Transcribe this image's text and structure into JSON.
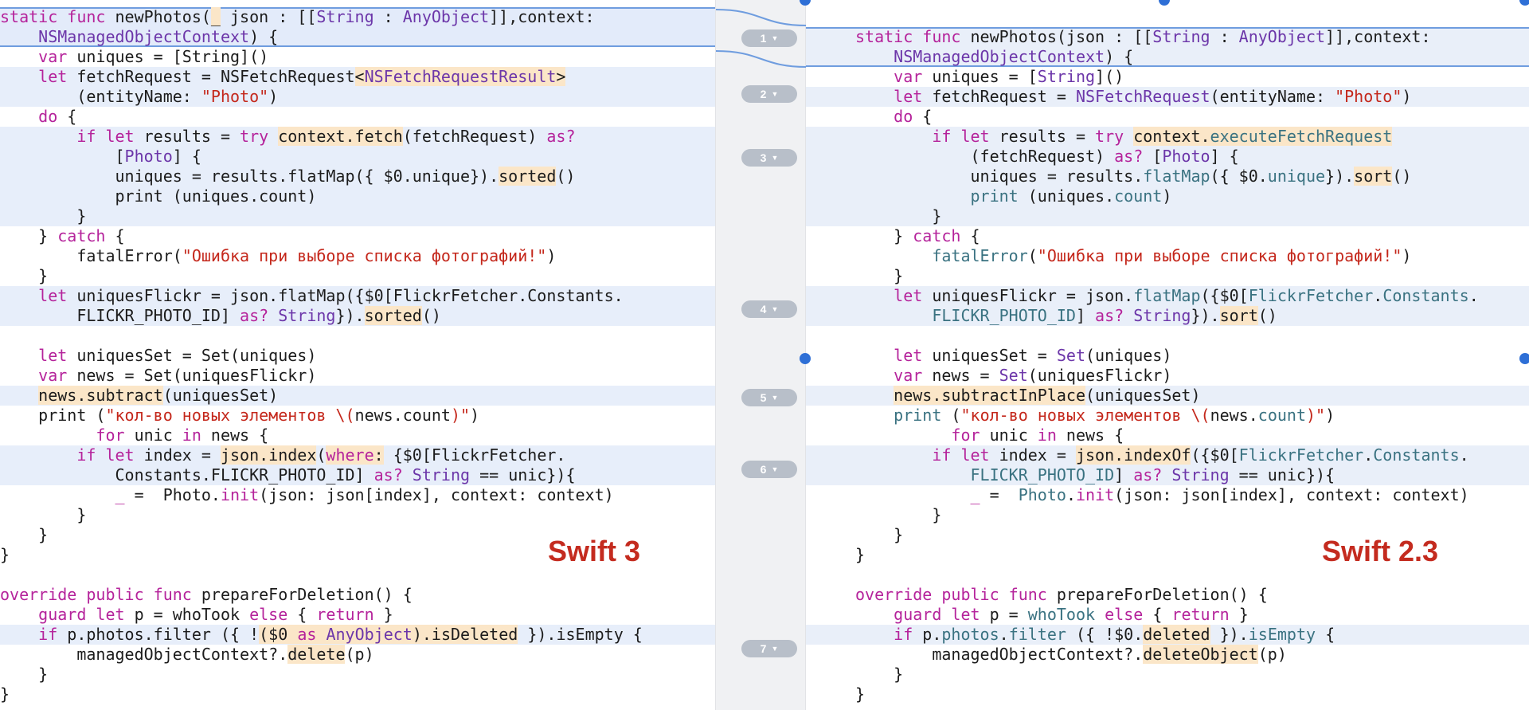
{
  "left_label": "Swift 3",
  "right_label": "Swift 2.3",
  "diff_markers": [
    "1",
    "2",
    "3",
    "4",
    "5",
    "6",
    "7"
  ],
  "colors": {
    "keyword": "#b5239b",
    "type": "#6c36a9",
    "string": "#c4271b",
    "function": "#3a7281",
    "change_highlight": "#fbe6c8",
    "diff_band": "#e7eefa",
    "accent": "#2e6fd6",
    "label": "#c42b1f"
  },
  "left_lines": [
    [
      [
        "kw",
        "static "
      ],
      [
        "kw",
        "func"
      ],
      [
        "",
        " newPhotos("
      ],
      [
        "ch",
        "_"
      ],
      [
        "",
        " json : [["
      ],
      [
        "ty",
        "String"
      ],
      [
        "",
        " : "
      ],
      [
        "ty",
        "AnyObject"
      ],
      [
        "",
        "]],context:"
      ]
    ],
    [
      [
        "",
        "    "
      ],
      [
        "ty",
        "NSManagedObjectContext"
      ],
      [
        "",
        ") {"
      ]
    ],
    [
      [
        "",
        "    "
      ],
      [
        "kw",
        "var"
      ],
      [
        "",
        " uniques = [String]()"
      ]
    ],
    [
      [
        "",
        "    "
      ],
      [
        "kw",
        "let"
      ],
      [
        "",
        " fetchRequest = NSFetchRequest"
      ],
      [
        "ch",
        "<"
      ],
      [
        "ch ty",
        "NSFetchRequestResult"
      ],
      [
        "ch",
        ">"
      ]
    ],
    [
      [
        "",
        "        (entityName: "
      ],
      [
        "st",
        "\"Photo\""
      ],
      [
        "",
        ")"
      ]
    ],
    [
      [
        "",
        "    "
      ],
      [
        "kw",
        "do"
      ],
      [
        "",
        " {"
      ]
    ],
    [
      [
        "",
        "        "
      ],
      [
        "kw",
        "if let"
      ],
      [
        "",
        " results = "
      ],
      [
        "kw",
        "try"
      ],
      [
        "",
        " "
      ],
      [
        "ch",
        "context.fetch"
      ],
      [
        "",
        "(fetchRequest) "
      ],
      [
        "kw",
        "as?"
      ]
    ],
    [
      [
        "",
        "            ["
      ],
      [
        "ty",
        "Photo"
      ],
      [
        "",
        "] {"
      ]
    ],
    [
      [
        "",
        "            uniques = results.flatMap({ $0.unique})."
      ],
      [
        "ch",
        "sorted"
      ],
      [
        "",
        "()"
      ]
    ],
    [
      [
        "",
        "            print (uniques.count)"
      ]
    ],
    [
      [
        "",
        "        }"
      ]
    ],
    [
      [
        "",
        "    } "
      ],
      [
        "kw",
        "catch"
      ],
      [
        "",
        " {"
      ]
    ],
    [
      [
        "",
        "        fatalError("
      ],
      [
        "st",
        "\"Ошибка при выборе списка фотографий!\""
      ],
      [
        "",
        ")"
      ]
    ],
    [
      [
        "",
        "    }"
      ]
    ],
    [
      [
        "",
        "    "
      ],
      [
        "kw",
        "let"
      ],
      [
        "",
        " uniquesFlickr = json.flatMap({$0[FlickrFetcher.Constants."
      ]
    ],
    [
      [
        "",
        "        FLICKR_PHOTO_ID] "
      ],
      [
        "kw",
        "as?"
      ],
      [
        "",
        " "
      ],
      [
        "ty",
        "String"
      ],
      [
        "",
        "})."
      ],
      [
        "ch",
        "sorted"
      ],
      [
        "",
        "()"
      ]
    ],
    [
      [
        "",
        ""
      ]
    ],
    [
      [
        "",
        "    "
      ],
      [
        "kw",
        "let"
      ],
      [
        "",
        " uniquesSet = Set(uniques)"
      ]
    ],
    [
      [
        "",
        "    "
      ],
      [
        "kw",
        "var"
      ],
      [
        "",
        " news = Set(uniquesFlickr)"
      ]
    ],
    [
      [
        "",
        "    "
      ],
      [
        "ch",
        "news.subtract"
      ],
      [
        "",
        "(uniquesSet)"
      ]
    ],
    [
      [
        "",
        "    print ("
      ],
      [
        "st",
        "\"кол-во новых элементов \\("
      ],
      [
        "",
        "news.count"
      ],
      [
        "st",
        ")\""
      ],
      [
        "",
        ")"
      ]
    ],
    [
      [
        "",
        "          "
      ],
      [
        "kw",
        "for"
      ],
      [
        "",
        " unic "
      ],
      [
        "kw",
        "in"
      ],
      [
        "",
        " news {"
      ]
    ],
    [
      [
        "",
        "        "
      ],
      [
        "kw",
        "if let"
      ],
      [
        "",
        " index = "
      ],
      [
        "ch",
        "json.index"
      ],
      [
        "",
        "("
      ],
      [
        "ch kw",
        "where"
      ],
      [
        "ch",
        ":"
      ],
      [
        "",
        " {$0[FlickrFetcher."
      ]
    ],
    [
      [
        "",
        "            Constants.FLICKR_PHOTO_ID] "
      ],
      [
        "kw",
        "as?"
      ],
      [
        "",
        " "
      ],
      [
        "ty",
        "String"
      ],
      [
        "",
        " == unic}){"
      ]
    ],
    [
      [
        "",
        "            "
      ],
      [
        "kw",
        "_"
      ],
      [
        "",
        " =  Photo."
      ],
      [
        "kw",
        "init"
      ],
      [
        "",
        "(json: json[index], context: context)"
      ]
    ],
    [
      [
        "",
        "        }"
      ]
    ],
    [
      [
        "",
        "    }"
      ]
    ],
    [
      [
        "",
        "}"
      ]
    ],
    [
      [
        "",
        ""
      ]
    ],
    [
      [
        "kw",
        "override public func"
      ],
      [
        "",
        " prepareForDeletion() {"
      ]
    ],
    [
      [
        "",
        "    "
      ],
      [
        "kw",
        "guard let"
      ],
      [
        "",
        " p = whoTook "
      ],
      [
        "kw",
        "else"
      ],
      [
        "",
        " { "
      ],
      [
        "kw",
        "return"
      ],
      [
        "",
        " }"
      ]
    ],
    [
      [
        "",
        "    "
      ],
      [
        "kw",
        "if"
      ],
      [
        "",
        " p.photos.filter ({ !"
      ],
      [
        "ch",
        "($0 "
      ],
      [
        "ch kw",
        "as"
      ],
      [
        "ch",
        " "
      ],
      [
        "ch ty",
        "AnyObject"
      ],
      [
        "ch",
        ")."
      ],
      [
        "ch",
        "isDeleted"
      ],
      [
        "",
        " }).isEmpty {"
      ]
    ],
    [
      [
        "",
        "        managedObjectContext?."
      ],
      [
        "ch",
        "delete"
      ],
      [
        "",
        "(p)"
      ]
    ],
    [
      [
        "",
        "    }"
      ]
    ],
    [
      [
        "",
        "}"
      ]
    ]
  ],
  "right_lines": [
    [
      [
        "",
        ""
      ]
    ],
    [
      [
        "kw",
        "static func"
      ],
      [
        "",
        " newPhotos(json : [["
      ],
      [
        "ty",
        "String"
      ],
      [
        "",
        " : "
      ],
      [
        "ty",
        "AnyObject"
      ],
      [
        "",
        "]],context:"
      ]
    ],
    [
      [
        "",
        "    "
      ],
      [
        "ty",
        "NSManagedObjectContext"
      ],
      [
        "",
        ") {"
      ]
    ],
    [
      [
        "",
        "    "
      ],
      [
        "kw",
        "var"
      ],
      [
        "",
        " uniques = ["
      ],
      [
        "ty",
        "String"
      ],
      [
        "",
        "]()"
      ]
    ],
    [
      [
        "",
        "    "
      ],
      [
        "kw",
        "let"
      ],
      [
        "",
        " fetchRequest = "
      ],
      [
        "ty",
        "NSFetchRequest"
      ],
      [
        "",
        "(entityName: "
      ],
      [
        "st",
        "\"Photo\""
      ],
      [
        "",
        ")"
      ]
    ],
    [
      [
        "",
        "    "
      ],
      [
        "kw",
        "do"
      ],
      [
        "",
        " {"
      ]
    ],
    [
      [
        "",
        "        "
      ],
      [
        "kw",
        "if let"
      ],
      [
        "",
        " results = "
      ],
      [
        "kw",
        "try"
      ],
      [
        "",
        " "
      ],
      [
        "ch",
        "context."
      ],
      [
        "ch fn",
        "executeFetchRequest"
      ]
    ],
    [
      [
        "",
        "            (fetchRequest) "
      ],
      [
        "kw",
        "as?"
      ],
      [
        "",
        " ["
      ],
      [
        "ty",
        "Photo"
      ],
      [
        "",
        "] {"
      ]
    ],
    [
      [
        "",
        "            uniques = results."
      ],
      [
        "fn",
        "flatMap"
      ],
      [
        "",
        "({ $0."
      ],
      [
        "fn",
        "unique"
      ],
      [
        "",
        "})."
      ],
      [
        "ch",
        "sort"
      ],
      [
        "",
        "()"
      ]
    ],
    [
      [
        "",
        "            "
      ],
      [
        "fn",
        "print"
      ],
      [
        "",
        " (uniques."
      ],
      [
        "fn",
        "count"
      ],
      [
        "",
        ")"
      ]
    ],
    [
      [
        "",
        "        }"
      ]
    ],
    [
      [
        "",
        "    } "
      ],
      [
        "kw",
        "catch"
      ],
      [
        "",
        " {"
      ]
    ],
    [
      [
        "",
        "        "
      ],
      [
        "fn",
        "fatalError"
      ],
      [
        "",
        "("
      ],
      [
        "st",
        "\"Ошибка при выборе списка фотографий!\""
      ],
      [
        "",
        ")"
      ]
    ],
    [
      [
        "",
        "    }"
      ]
    ],
    [
      [
        "",
        "    "
      ],
      [
        "kw",
        "let"
      ],
      [
        "",
        " uniquesFlickr = json."
      ],
      [
        "fn",
        "flatMap"
      ],
      [
        "",
        "({$0["
      ],
      [
        "fn",
        "FlickrFetcher"
      ],
      [
        "",
        "."
      ],
      [
        "fn",
        "Constants"
      ],
      [
        "",
        "."
      ]
    ],
    [
      [
        "",
        "        "
      ],
      [
        "fn",
        "FLICKR_PHOTO_ID"
      ],
      [
        "",
        "] "
      ],
      [
        "kw",
        "as?"
      ],
      [
        "",
        " "
      ],
      [
        "ty",
        "String"
      ],
      [
        "",
        "})."
      ],
      [
        "ch",
        "sort"
      ],
      [
        "",
        "()"
      ]
    ],
    [
      [
        "",
        ""
      ]
    ],
    [
      [
        "",
        "    "
      ],
      [
        "kw",
        "let"
      ],
      [
        "",
        " uniquesSet = "
      ],
      [
        "ty",
        "Set"
      ],
      [
        "",
        "(uniques)"
      ]
    ],
    [
      [
        "",
        "    "
      ],
      [
        "kw",
        "var"
      ],
      [
        "",
        " news = "
      ],
      [
        "ty",
        "Set"
      ],
      [
        "",
        "(uniquesFlickr)"
      ]
    ],
    [
      [
        "",
        "    "
      ],
      [
        "ch",
        "news.subtractInPlace"
      ],
      [
        "",
        "(uniquesSet)"
      ]
    ],
    [
      [
        "",
        "    "
      ],
      [
        "fn",
        "print"
      ],
      [
        "",
        " ("
      ],
      [
        "st",
        "\"кол-во новых элементов \\("
      ],
      [
        "",
        "news."
      ],
      [
        "fn",
        "count"
      ],
      [
        "st",
        ")\""
      ],
      [
        "",
        ")"
      ]
    ],
    [
      [
        "",
        "          "
      ],
      [
        "kw",
        "for"
      ],
      [
        "",
        " unic "
      ],
      [
        "kw",
        "in"
      ],
      [
        "",
        " news {"
      ]
    ],
    [
      [
        "",
        "        "
      ],
      [
        "kw",
        "if let"
      ],
      [
        "",
        " index = "
      ],
      [
        "ch",
        "json.indexOf"
      ],
      [
        "",
        "({$0["
      ],
      [
        "fn",
        "FlickrFetcher"
      ],
      [
        "",
        "."
      ],
      [
        "fn",
        "Constants"
      ],
      [
        "",
        "."
      ]
    ],
    [
      [
        "",
        "            "
      ],
      [
        "fn",
        "FLICKR_PHOTO_ID"
      ],
      [
        "",
        "] "
      ],
      [
        "kw",
        "as?"
      ],
      [
        "",
        " "
      ],
      [
        "ty",
        "String"
      ],
      [
        "",
        " == unic}){"
      ]
    ],
    [
      [
        "",
        "            "
      ],
      [
        "kw",
        "_"
      ],
      [
        "",
        " =  "
      ],
      [
        "fn",
        "Photo"
      ],
      [
        "",
        "."
      ],
      [
        "kw",
        "init"
      ],
      [
        "",
        "(json: json[index], context: context)"
      ]
    ],
    [
      [
        "",
        "        }"
      ]
    ],
    [
      [
        "",
        "    }"
      ]
    ],
    [
      [
        "",
        "}"
      ]
    ],
    [
      [
        "",
        ""
      ]
    ],
    [
      [
        "kw",
        "override public func"
      ],
      [
        "",
        " prepareForDeletion() {"
      ]
    ],
    [
      [
        "",
        "    "
      ],
      [
        "kw",
        "guard let"
      ],
      [
        "",
        " p = "
      ],
      [
        "fn",
        "whoTook"
      ],
      [
        "",
        " "
      ],
      [
        "kw",
        "else"
      ],
      [
        "",
        " { "
      ],
      [
        "kw",
        "return"
      ],
      [
        "",
        " }"
      ]
    ],
    [
      [
        "",
        "    "
      ],
      [
        "kw",
        "if"
      ],
      [
        "",
        " p."
      ],
      [
        "fn",
        "photos"
      ],
      [
        "",
        "."
      ],
      [
        "fn",
        "filter"
      ],
      [
        "",
        " ({ !$0."
      ],
      [
        "ch",
        "deleted"
      ],
      [
        "",
        " })."
      ],
      [
        "fn",
        "isEmpty"
      ],
      [
        "",
        " {"
      ]
    ],
    [
      [
        "",
        "        managedObjectContext?."
      ],
      [
        "ch",
        "deleteObject"
      ],
      [
        "",
        "(p)"
      ]
    ],
    [
      [
        "",
        "    }"
      ]
    ],
    [
      [
        "",
        "}"
      ]
    ]
  ]
}
